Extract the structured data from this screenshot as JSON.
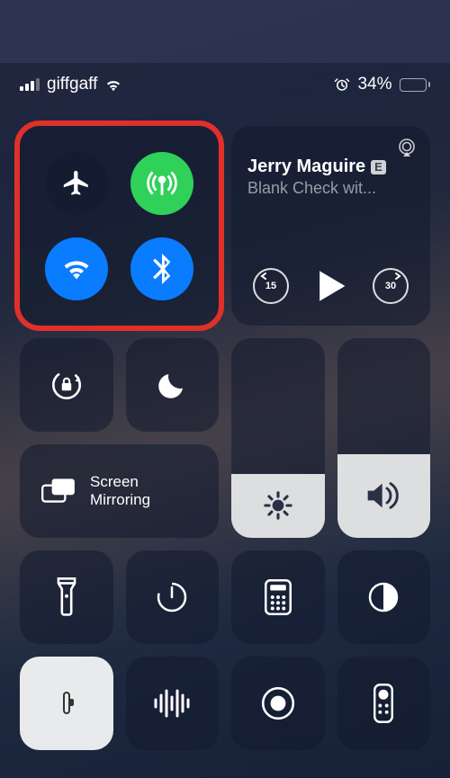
{
  "status": {
    "carrier": "giffgaff",
    "battery_pct": "34%",
    "battery_level": 34,
    "alarm_set": true,
    "signal_bars": 3,
    "wifi_connected": true
  },
  "connectivity": {
    "airplane": {
      "name": "airplane-mode",
      "on": false
    },
    "cellular": {
      "name": "cellular-data",
      "on": true
    },
    "wifi": {
      "name": "wifi",
      "on": true
    },
    "bluetooth": {
      "name": "bluetooth",
      "on": true
    },
    "highlighted": true
  },
  "media": {
    "title": "Jerry Maguire",
    "explicit_badge": "E",
    "subtitle": "Blank Check wit...",
    "skip_back_seconds": "15",
    "skip_fwd_seconds": "30",
    "playing": false
  },
  "toggles": {
    "orientation_lock": {
      "on": false
    },
    "do_not_disturb": {
      "on": false
    }
  },
  "screen_mirroring": {
    "label_line1": "Screen",
    "label_line2": "Mirroring"
  },
  "sliders": {
    "brightness": {
      "level_pct": 32
    },
    "volume": {
      "level_pct": 42
    }
  },
  "shortcuts_row1": {
    "flashlight": {
      "on": false
    },
    "timer": {},
    "calculator": {},
    "dark_mode": {}
  },
  "shortcuts_row2": {
    "low_power": {
      "on": true,
      "battery_pct": 34
    },
    "sound_recog": {},
    "screen_record": {},
    "remote": {}
  }
}
